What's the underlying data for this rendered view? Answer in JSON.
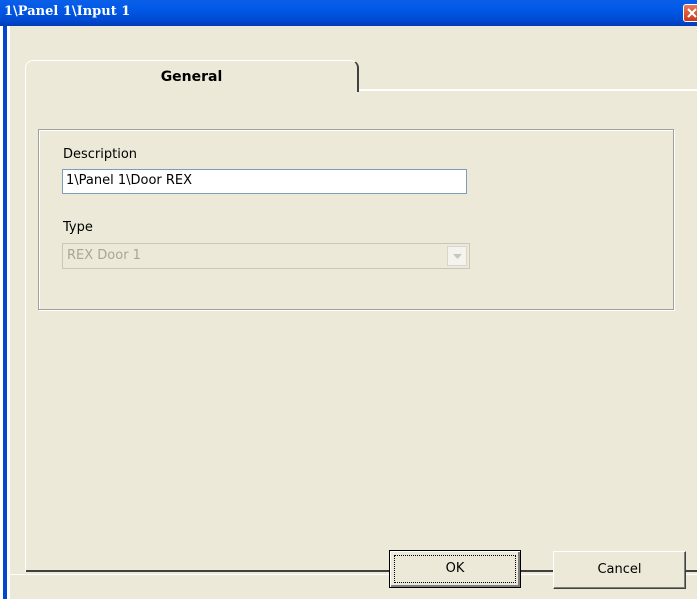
{
  "window": {
    "title": "1\\Panel 1\\Input 1",
    "close_icon": "close-icon"
  },
  "tabs": [
    {
      "label": "General",
      "selected": true
    }
  ],
  "form": {
    "description_label": "Description",
    "description_value": "1\\Panel 1\\Door REX",
    "type_label": "Type",
    "type_value": "REX Door 1",
    "type_disabled": true
  },
  "buttons": {
    "ok_label": "OK",
    "cancel_label": "Cancel"
  },
  "colors": {
    "title_bar": "#0054e3",
    "dialog_face": "#ece9d8",
    "close_button": "#d2472a"
  }
}
